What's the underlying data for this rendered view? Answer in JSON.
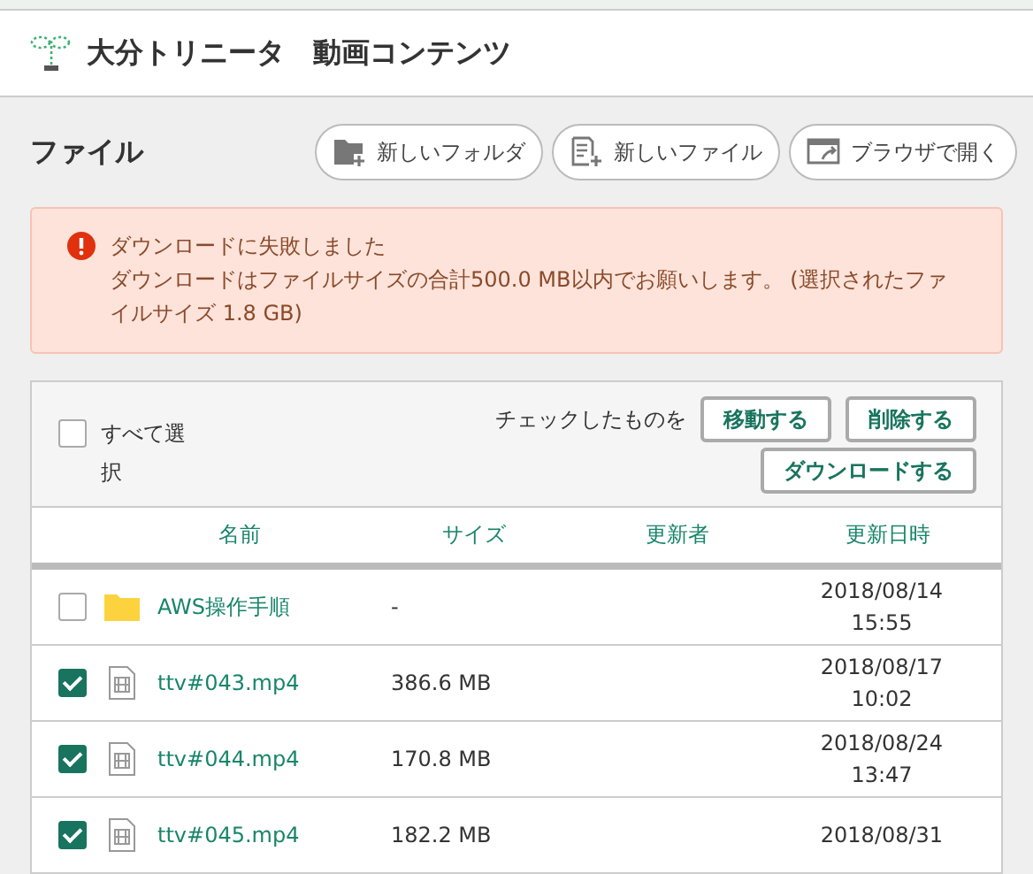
{
  "header": {
    "title": "大分トリニータ　動画コンテンツ"
  },
  "toolbar": {
    "title": "ファイル",
    "buttons": [
      {
        "kind": "folder",
        "label": "新しいフォルダ"
      },
      {
        "kind": "file",
        "label": "新しいファイル"
      },
      {
        "kind": "browser",
        "label": "ブラウザで開く"
      }
    ]
  },
  "alert": {
    "title": "ダウンロードに失敗しました",
    "message": "ダウンロードはファイルサイズの合計500.0 MB以内でお願いします。 (選択されたファイルサイズ 1.8 GB)"
  },
  "bulk": {
    "select_all": {
      "label": "すべて選択",
      "checked": false
    },
    "prompt": "チェックしたものを",
    "actions": [
      "移動する",
      "削除する",
      "ダウンロードする"
    ]
  },
  "table": {
    "columns": [
      "名前",
      "サイズ",
      "更新者",
      "更新日時"
    ],
    "rows": [
      {
        "kind": "folder",
        "checked": false,
        "name": "AWS操作手順",
        "size": "-",
        "date": "2018/08/14",
        "time": "15:55"
      },
      {
        "kind": "file",
        "checked": true,
        "name": "ttv#043.mp4",
        "size": "386.6 MB",
        "date": "2018/08/17",
        "time": "10:02"
      },
      {
        "kind": "file",
        "checked": true,
        "name": "ttv#044.mp4",
        "size": "170.8 MB",
        "date": "2018/08/24",
        "time": "13:47"
      },
      {
        "kind": "file",
        "checked": true,
        "name": "ttv#045.mp4",
        "size": "182.2 MB",
        "date": "2018/08/31"
      }
    ]
  }
}
